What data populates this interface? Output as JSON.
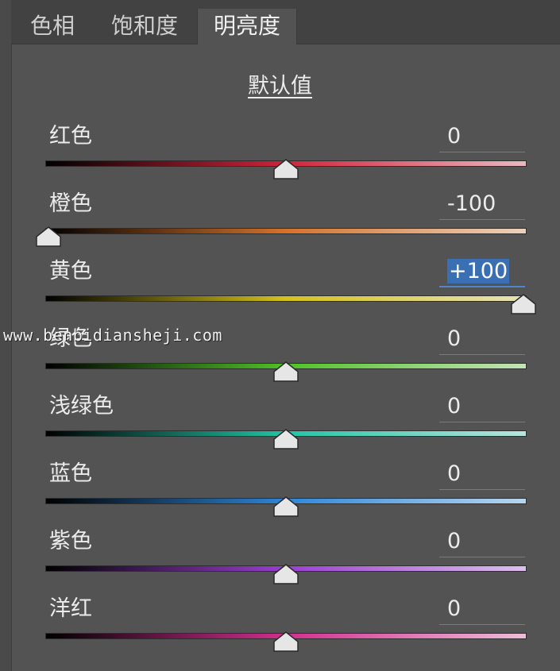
{
  "tabs": [
    {
      "label": "色相",
      "active": false
    },
    {
      "label": "饱和度",
      "active": false
    },
    {
      "label": "明亮度",
      "active": true
    }
  ],
  "default_link": "默认值",
  "sliders": [
    {
      "label": "红色",
      "value": "0",
      "level": 0,
      "selected": false,
      "gradient": [
        "#000000",
        "#d0243a",
        "#e9b8c0"
      ]
    },
    {
      "label": "橙色",
      "value": "-100",
      "level": -100,
      "selected": false,
      "gradient": [
        "#000000",
        "#d5722a",
        "#ead2bd"
      ]
    },
    {
      "label": "黄色",
      "value": "+100",
      "level": 100,
      "selected": true,
      "gradient": [
        "#000000",
        "#d4c21c",
        "#e8e3b8"
      ]
    },
    {
      "label": "绿色",
      "value": "0",
      "level": 0,
      "selected": false,
      "gradient": [
        "#000000",
        "#4fc227",
        "#c4e3b7"
      ]
    },
    {
      "label": "浅绿色",
      "value": "0",
      "level": 0,
      "selected": false,
      "gradient": [
        "#000000",
        "#23c4a6",
        "#b8e5dc"
      ]
    },
    {
      "label": "蓝色",
      "value": "0",
      "level": 0,
      "selected": false,
      "gradient": [
        "#000000",
        "#2e86d9",
        "#b9d6ee"
      ]
    },
    {
      "label": "紫色",
      "value": "0",
      "level": 0,
      "selected": false,
      "gradient": [
        "#000000",
        "#9a3fd1",
        "#dcc0ec"
      ]
    },
    {
      "label": "洋红",
      "value": "0",
      "level": 0,
      "selected": false,
      "gradient": [
        "#000000",
        "#d12f8f",
        "#ecbdd8"
      ]
    }
  ],
  "watermark": "www.benbidiansheji.com",
  "colors": {
    "panel_bg": "#535353",
    "tab_bar_bg": "#424242",
    "selection_blue": "#3a6fb3",
    "thumb_fill": "#e6e6e6"
  }
}
